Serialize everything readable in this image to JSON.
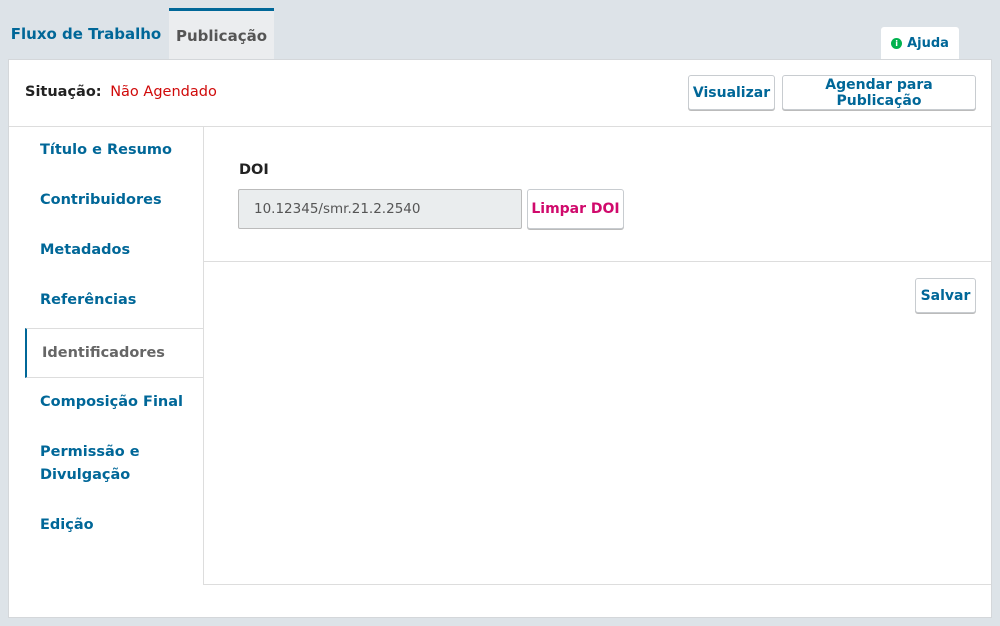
{
  "tabs": {
    "workflow": "Fluxo de Trabalho",
    "publication": "Publicação"
  },
  "help": {
    "label": "Ajuda",
    "icon": "info-icon"
  },
  "status": {
    "label": "Situação:",
    "value": "Não Agendado",
    "value_color": "#d00a0a"
  },
  "actions": {
    "preview": "Visualizar",
    "schedule": "Agendar para Publicação"
  },
  "sidebar": {
    "items": [
      {
        "label": "Título e Resumo",
        "active": false
      },
      {
        "label": "Contribuidores",
        "active": false
      },
      {
        "label": "Metadados",
        "active": false
      },
      {
        "label": "Referências",
        "active": false
      },
      {
        "label": "Identificadores",
        "active": true
      },
      {
        "label": "Composição Final",
        "active": false
      },
      {
        "label": "Permissão e Divulgação",
        "active": false
      },
      {
        "label": "Edição",
        "active": false
      }
    ]
  },
  "form": {
    "doi_label": "DOI",
    "doi_value": "10.12345/smr.21.2.2540",
    "clear_label": "Limpar DOI",
    "save_label": "Salvar"
  },
  "colors": {
    "accent": "#006798",
    "danger": "#d00a0a",
    "clear_button": "#d00a6c",
    "help_icon": "#00b24e"
  }
}
